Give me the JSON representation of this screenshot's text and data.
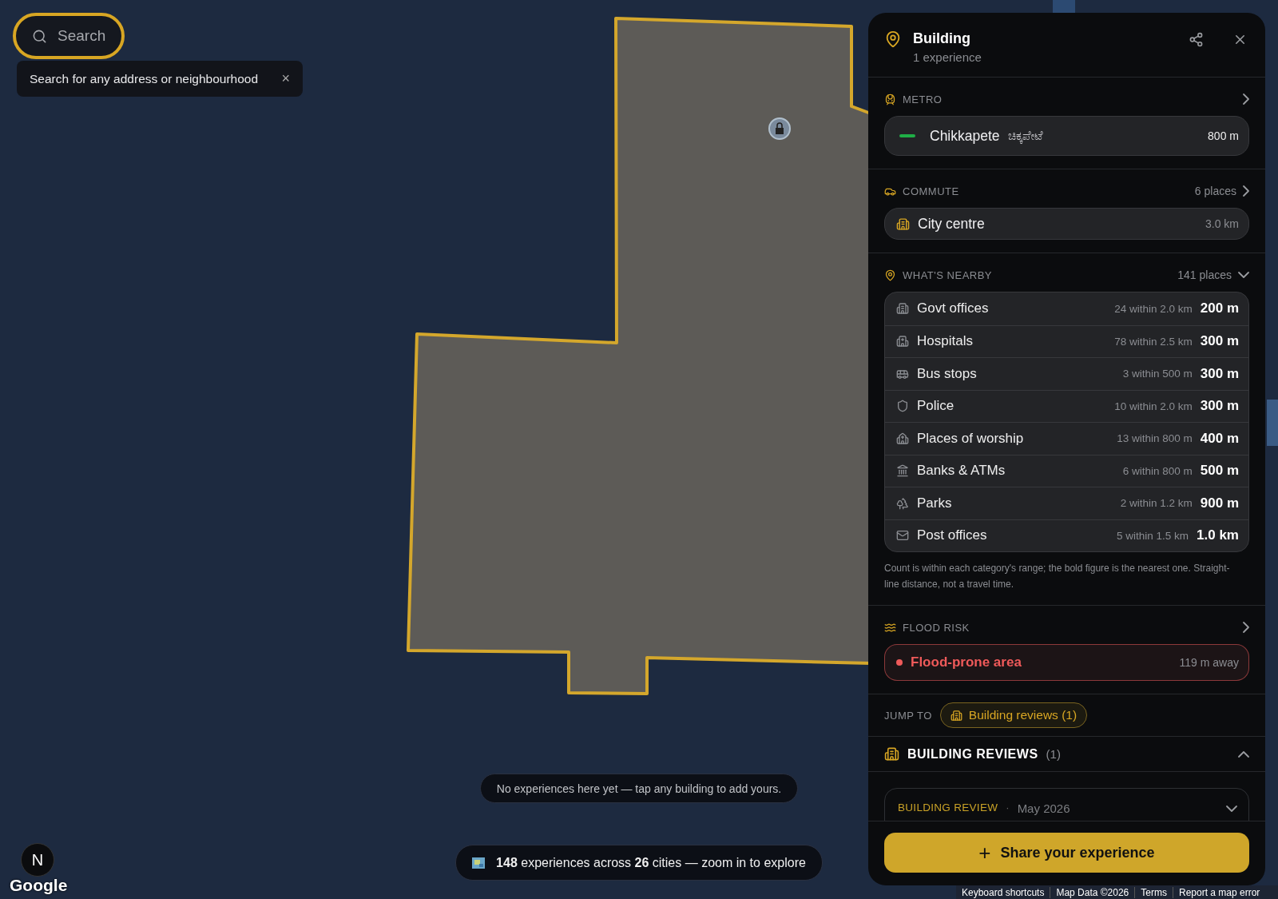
{
  "search": {
    "placeholder": "Search",
    "focused": true
  },
  "tooltip": {
    "text": "Search for any address or neighbourhood",
    "close": "×"
  },
  "panel": {
    "title": "Building",
    "subtitle": "1 experience",
    "metro": {
      "label": "METRO",
      "station": "Chikkapete",
      "station_local": "ಚಿಕ್ಕಪೇಟೆ",
      "distance": "800 m",
      "color": "#1fae46"
    },
    "commute": {
      "label": "COMMUTE",
      "count": "6 places",
      "place": "City centre",
      "distance": "3.0 km"
    },
    "nearby": {
      "label": "WHAT'S NEARBY",
      "count": "141 places",
      "expanded": true,
      "rows": [
        {
          "kind": "office",
          "name": "Govt offices",
          "count": "24 within 2.0 km",
          "nearest": "200 m"
        },
        {
          "kind": "hospital",
          "name": "Hospitals",
          "count": "78 within 2.5 km",
          "nearest": "300 m"
        },
        {
          "kind": "bus",
          "name": "Bus stops",
          "count": "3 within 500 m",
          "nearest": "300 m"
        },
        {
          "kind": "shield",
          "name": "Police",
          "count": "10 within 2.0 km",
          "nearest": "300 m"
        },
        {
          "kind": "worship",
          "name": "Places of worship",
          "count": "13 within 800 m",
          "nearest": "400 m"
        },
        {
          "kind": "bank",
          "name": "Banks & ATMs",
          "count": "6 within 800 m",
          "nearest": "500 m"
        },
        {
          "kind": "park",
          "name": "Parks",
          "count": "2 within 1.2 km",
          "nearest": "900 m"
        },
        {
          "kind": "mail",
          "name": "Post offices",
          "count": "5 within 1.5 km",
          "nearest": "1.0 km"
        }
      ],
      "note": "Count is within each category's range; the bold figure is the nearest one. Straight-line distance, not a travel time."
    },
    "flood": {
      "label": "FLOOD RISK",
      "status": "Flood-prone area",
      "distance": "119 m away",
      "color": "#ef5a5a"
    },
    "jump": {
      "label": "JUMP TO",
      "chip": "Building reviews (1)"
    },
    "reviews": {
      "title": "BUILDING REVIEWS",
      "count": "(1)",
      "expanded": true,
      "items": [
        {
          "type": "BUILDING REVIEW",
          "separator": "·",
          "date": "May 2026",
          "expanded": false
        }
      ]
    },
    "action": {
      "icon": "+",
      "label": "Share your experience"
    }
  },
  "map_toasts": [
    {
      "text": "No experiences here yet — tap any building to add yours.",
      "kind": "hint"
    },
    {
      "text": "**148** experiences across **26** cities — zoom in to explore",
      "kind": "stats"
    }
  ],
  "dev_badge": "N",
  "map_logo": "Google",
  "map_footer": [
    "Keyboard shortcuts",
    "Map Data ©2026",
    "Terms",
    "Report a map error"
  ]
}
